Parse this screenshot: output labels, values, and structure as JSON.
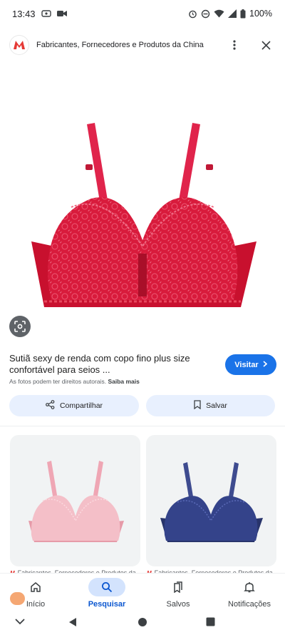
{
  "status_bar": {
    "time": "13:43",
    "battery": "100%"
  },
  "site": {
    "logo_letter": "M",
    "title": "Fabricantes, Fornecedores e Produtos da China"
  },
  "product": {
    "title": "Sutiã sexy de renda com copo fino plus size confortável para seios ...",
    "visit_label": "Visitar",
    "copyright_text": "As fotos podem ter direitos autorais.",
    "learn_more": "Saiba mais",
    "share_label": "Compartilhar",
    "save_label": "Salvar"
  },
  "related": [
    {
      "source": "Fabricantes, Fornecedores e Produtos da",
      "color": "#f2b8c0"
    },
    {
      "source": "Fabricantes, Fornecedores e Produtos da",
      "color": "#2f3e7a"
    }
  ],
  "bottom_nav": [
    {
      "label": "Início",
      "icon": "home-icon",
      "active": false
    },
    {
      "label": "Pesquisar",
      "icon": "search-icon",
      "active": true
    },
    {
      "label": "Salvos",
      "icon": "bookmarks-icon",
      "active": false
    },
    {
      "label": "Notificações",
      "icon": "bell-icon",
      "active": false
    }
  ],
  "colors": {
    "accent": "#1a73e8",
    "brand": "#e53935",
    "hero_product": "#d81b3c"
  }
}
